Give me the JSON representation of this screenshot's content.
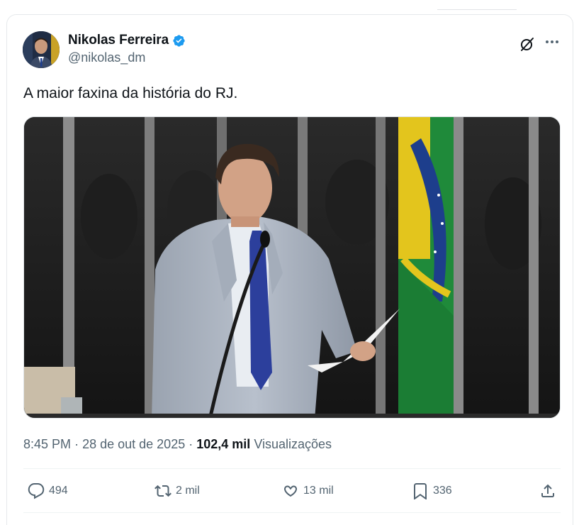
{
  "author": {
    "display_name": "Nikolas Ferreira",
    "handle": "@nikolas_dm",
    "verified": true
  },
  "tweet": {
    "text": "A maior faxina da história do RJ.",
    "time": "8:45 PM",
    "date": "28 de out de 2025",
    "views_count": "102,4 mil",
    "views_label": "Visualizações",
    "separator": "·"
  },
  "media": {
    "type": "video-still",
    "description_icon": "speaker-at-podium-image"
  },
  "stats": {
    "replies": "494",
    "reposts": "2 mil",
    "likes": "13 mil",
    "bookmarks": "336"
  },
  "icons": {
    "verified": "verified-badge-icon",
    "grok": "grok-icon",
    "more": "more-icon",
    "reply": "reply-icon",
    "repost": "repost-icon",
    "like": "heart-icon",
    "bookmark": "bookmark-icon",
    "share": "share-icon"
  },
  "colors": {
    "accent": "#1d9bf0",
    "text": "#0f1419",
    "secondary": "#536471"
  }
}
